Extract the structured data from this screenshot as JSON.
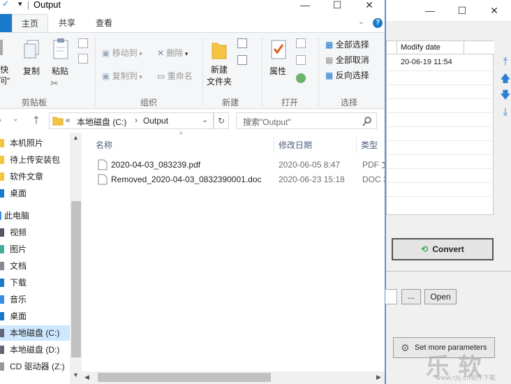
{
  "background_app": {
    "window_buttons": {
      "minimize": "—",
      "maximize": "☐",
      "close": "✕"
    },
    "list": {
      "column_header": "Modify date",
      "rows": [
        {
          "modify_date": "20-06-19 11:54"
        }
      ]
    },
    "side_buttons": [
      "move-top",
      "move-up",
      "move-down",
      "move-bottom"
    ],
    "convert_label": "Convert",
    "browse_label": "...",
    "open_label": "Open",
    "set_more_label": "Set more parameters"
  },
  "explorer": {
    "title": "Output",
    "quick_access_glyphs": {
      "check": "✓",
      "dropdown": "▾"
    },
    "window_buttons": {
      "minimize": "—",
      "maximize": "☐",
      "close": "✕"
    },
    "help_glyph": "?",
    "tabs": {
      "file": "",
      "home": "主页",
      "share": "共享",
      "view": "查看"
    },
    "ribbon": {
      "clipboard": {
        "pin_label": "\"快",
        "pin_label2": "问\"",
        "copy": "复制",
        "paste": "粘贴",
        "group": "剪贴板"
      },
      "organize": {
        "move_to": "移动到",
        "copy_to": "复制到",
        "delete": "删除",
        "rename": "重命名",
        "group": "组织"
      },
      "new": {
        "new_folder_line1": "新建",
        "new_folder_line2": "文件夹",
        "group": "新建"
      },
      "open": {
        "properties": "属性",
        "group": "打开"
      },
      "select": {
        "select_all": "全部选择",
        "select_none": "全部取消",
        "invert": "反向选择",
        "group": "选择"
      }
    },
    "address": {
      "prefix": "«",
      "parts": [
        "本地磁盘 (C:)",
        "Output"
      ],
      "separator": "›"
    },
    "search_placeholder": "搜索\"Output\"",
    "nav": [
      {
        "label": "本机照片"
      },
      {
        "label": "待上传安装包"
      },
      {
        "label": "软件文章"
      },
      {
        "label": "桌面"
      },
      {
        "label": "此电脑"
      },
      {
        "label": "视频"
      },
      {
        "label": "图片"
      },
      {
        "label": "文档"
      },
      {
        "label": "下载"
      },
      {
        "label": "音乐"
      },
      {
        "label": "桌面"
      },
      {
        "label": "本地磁盘 (C:)"
      },
      {
        "label": "本地磁盘 (D:)"
      },
      {
        "label": "CD 驱动器 (Z:)"
      }
    ],
    "columns": {
      "name": "名称",
      "modified": "修改日期",
      "type": "类型"
    },
    "files": [
      {
        "name": "2020-04-03_083239.pdf",
        "modified": "2020-06-05 8:47",
        "type": "PDF 文"
      },
      {
        "name": "Removed_2020-04-03_0832390001.doc",
        "modified": "2020-06-23 15:18",
        "type": "DOC 3"
      }
    ]
  },
  "colors": {
    "accent": "#1979ca",
    "selection": "#cde8ff",
    "ribbon_bg": "#f5f6f7",
    "arrow_blue": "#2a7fd4"
  }
}
